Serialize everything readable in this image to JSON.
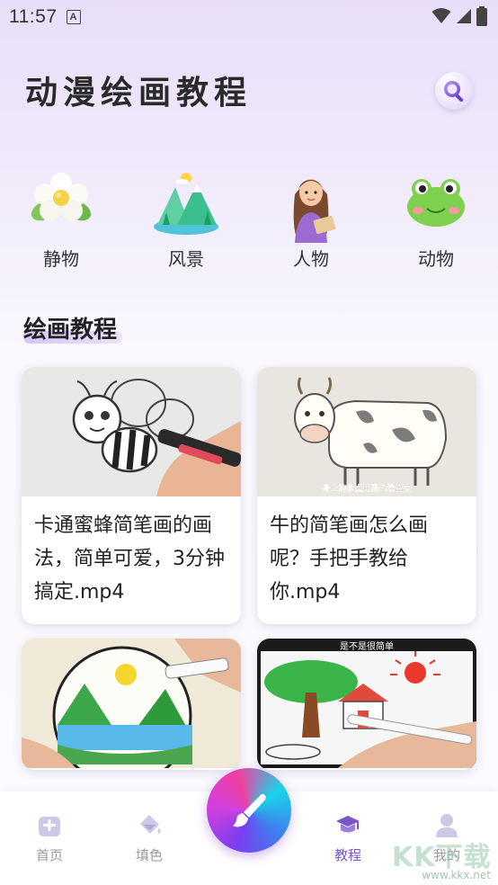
{
  "status_bar": {
    "time": "11:57",
    "notification_letter": "A"
  },
  "header": {
    "title": "动漫绘画教程"
  },
  "categories": [
    {
      "label": "静物",
      "icon": "flower-icon"
    },
    {
      "label": "风景",
      "icon": "mountain-landscape-icon"
    },
    {
      "label": "人物",
      "icon": "woman-figure-icon"
    },
    {
      "label": "动物",
      "icon": "frog-icon"
    }
  ],
  "section": {
    "title": "绘画教程"
  },
  "tutorials": [
    {
      "title": "卡通蜜蜂简笔画的画法，简单可爱，3分钟搞定.mp4",
      "thumb": "bee-drawing-thumbnail",
      "caption": ""
    },
    {
      "title": "牛的简笔画怎么画呢？手把手教给你.mp4",
      "thumb": "cow-drawing-thumbnail",
      "caption": "身上的斑点用黑色涂出来"
    },
    {
      "title": "",
      "thumb": "landscape-circle-drawing-thumbnail",
      "caption": ""
    },
    {
      "title": "",
      "thumb": "tree-house-drawing-thumbnail",
      "caption": "是不是很简单"
    }
  ],
  "bottom_nav": {
    "items": [
      {
        "label": "首页",
        "icon": "home-icon",
        "active": false
      },
      {
        "label": "填色",
        "icon": "paint-bucket-icon",
        "active": false
      },
      {
        "label": "教程",
        "icon": "graduation-cap-icon",
        "active": true
      },
      {
        "label": "我的",
        "icon": "user-icon",
        "active": false
      }
    ],
    "fab_icon": "paintbrush-icon"
  },
  "watermark": {
    "brand": "KK下载",
    "url": "www.kkx.net"
  },
  "colors": {
    "accent": "#7a55c9",
    "inactive": "#9a9a9a"
  }
}
